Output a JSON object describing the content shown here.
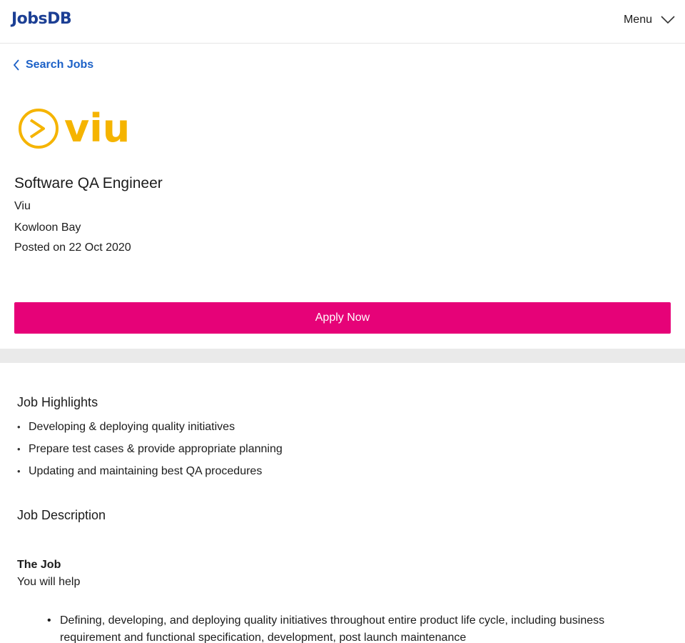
{
  "header": {
    "logo_text": "JobsDB",
    "menu_label": "Menu"
  },
  "nav": {
    "back_label": "Search Jobs"
  },
  "company_logo": {
    "text": "viu",
    "color": "#f5b400"
  },
  "job": {
    "title": "Software QA Engineer",
    "company": "Viu",
    "location": "Kowloon Bay",
    "posted": "Posted on 22 Oct 2020"
  },
  "apply_button": {
    "label": "Apply Now",
    "color": "#e60278"
  },
  "highlights": {
    "heading": "Job Highlights",
    "items": [
      "Developing & deploying quality initiatives",
      "Prepare test cases & provide appropriate planning",
      "Updating and maintaining best QA procedures"
    ]
  },
  "description": {
    "heading": "Job Description",
    "subheading": "The Job",
    "intro": "You will help",
    "items": [
      "Defining, developing, and deploying quality initiatives throughout entire product life cycle, including business requirement and functional specification, development, post launch maintenance"
    ]
  },
  "colors": {
    "brand_blue": "#1c3f94",
    "link_blue": "#1c61c7",
    "divider_gray": "#eaeaea"
  }
}
